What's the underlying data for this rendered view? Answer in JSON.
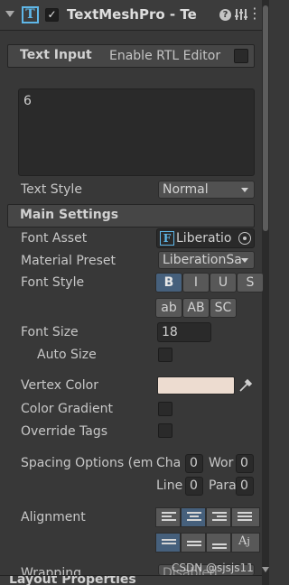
{
  "header": {
    "icon_letter": "T",
    "checkbox_mark": "✓",
    "title": "TextMeshPro - Te",
    "help": "?",
    "menu": "⋮"
  },
  "text_input": {
    "section_title": "Text Input",
    "rtl_label": "Enable RTL Editor",
    "rtl_enabled": false,
    "value": "6"
  },
  "text_style": {
    "label": "Text Style",
    "value": "Normal"
  },
  "main_settings": {
    "section_title": "Main Settings",
    "font_asset": {
      "label": "Font Asset",
      "icon_letter": "F",
      "value": "Liberatio"
    },
    "material_preset": {
      "label": "Material Preset",
      "value": "LiberationSa"
    },
    "font_style": {
      "label": "Font Style",
      "row1": [
        "B",
        "I",
        "U",
        "S"
      ],
      "row2": [
        "ab",
        "AB",
        "SC"
      ],
      "active": "B"
    },
    "font_size": {
      "label": "Font Size",
      "value": "18"
    },
    "auto_size": {
      "label": "Auto Size",
      "checked": false
    },
    "vertex_color": {
      "label": "Vertex Color",
      "color": "#eddcd0"
    },
    "color_gradient": {
      "label": "Color Gradient",
      "checked": false
    },
    "override_tags": {
      "label": "Override Tags",
      "checked": false
    },
    "spacing": {
      "label": "Spacing Options (em",
      "char_label": "Cha",
      "char_value": "0",
      "word_label": "Wor",
      "word_value": "0",
      "line_label": "Line",
      "line_value": "0",
      "para_label": "Para",
      "para_value": "0"
    },
    "alignment": {
      "label": "Alignment",
      "active_horizontal": "center",
      "active_vertical": "top"
    },
    "wrapping": {
      "label": "Wrapping",
      "value": "Disabled"
    }
  },
  "bottom_section": {
    "title": "Layout Properties"
  },
  "watermark": "CSDN @sjsjs11",
  "colors": {
    "accent": "#46607c",
    "icon_blue": "#5fb7e8"
  }
}
